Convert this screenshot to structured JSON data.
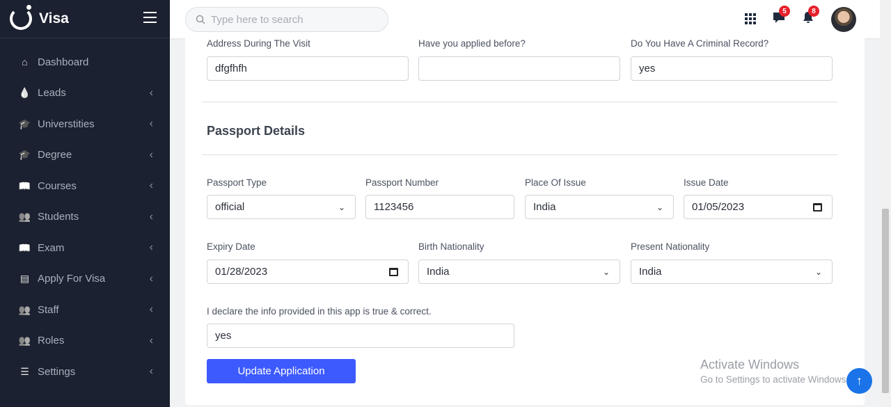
{
  "brand": {
    "name": "Visa"
  },
  "sidebar": {
    "items": [
      {
        "label": "Dashboard",
        "icon": "home-icon",
        "glyph": "⌂",
        "chev": false
      },
      {
        "label": "Leads",
        "icon": "droplet-icon",
        "glyph": "💧",
        "chev": true
      },
      {
        "label": "Universtities",
        "icon": "graduation-cap-icon",
        "glyph": "🎓",
        "chev": true
      },
      {
        "label": "Degree",
        "icon": "graduation-cap-icon",
        "glyph": "🎓",
        "chev": true
      },
      {
        "label": "Courses",
        "icon": "book-icon",
        "glyph": "📖",
        "chev": true
      },
      {
        "label": "Students",
        "icon": "users-icon",
        "glyph": "👥",
        "chev": true
      },
      {
        "label": "Exam",
        "icon": "book-icon",
        "glyph": "📖",
        "chev": true
      },
      {
        "label": "Apply For Visa",
        "icon": "id-card-icon",
        "glyph": "▤",
        "chev": true
      },
      {
        "label": "Staff",
        "icon": "users-icon",
        "glyph": "👥",
        "chev": true
      },
      {
        "label": "Roles",
        "icon": "users-icon",
        "glyph": "👥",
        "chev": true
      },
      {
        "label": "Settings",
        "icon": "sliders-icon",
        "glyph": "☰",
        "chev": true
      }
    ]
  },
  "topbar": {
    "search_placeholder": "Type here to search",
    "messages_count": "5",
    "notifications_count": "8"
  },
  "form": {
    "address_label": "Address During The Visit",
    "address_value": "dfgfhfh",
    "applied_label": "Have you applied before?",
    "applied_value": "",
    "criminal_label": "Do You Have A Criminal Record?",
    "criminal_value": "yes",
    "section_title": "Passport Details",
    "ptype_label": "Passport Type",
    "ptype_value": "official",
    "pnum_label": "Passport Number",
    "pnum_value": "1123456",
    "place_label": "Place Of Issue",
    "place_value": "India",
    "issue_label": "Issue Date",
    "issue_value": "01/05/2023",
    "expiry_label": "Expiry Date",
    "expiry_value": "01/28/2023",
    "birth_label": "Birth Nationality",
    "birth_value": "India",
    "present_label": "Present Nationality",
    "present_value": "India",
    "declare_label": "I declare the info provided in this app is true & correct.",
    "declare_value": "yes",
    "submit": "Update Application"
  },
  "watermark": {
    "line1": "Activate Windows",
    "line2": "Go to Settings to activate Windows."
  }
}
